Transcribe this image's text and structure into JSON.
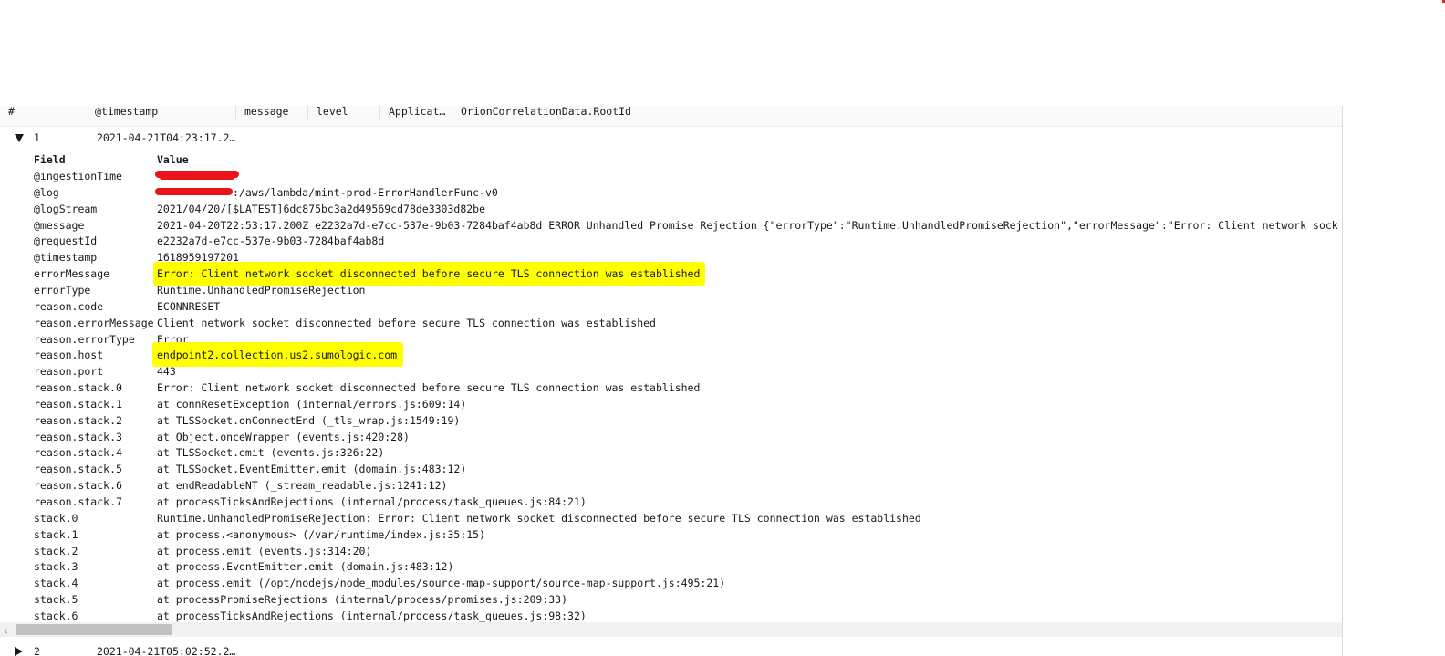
{
  "columns": [
    "#",
    "@timestamp",
    "message",
    "level",
    "Applicat…",
    "OrionCorrelationData.RootId"
  ],
  "rows": [
    {
      "num": "1",
      "timestamp": "2021-04-21T04:23:17.2…",
      "expanded": true
    },
    {
      "num": "2",
      "timestamp": "2021-04-21T05:02:52.2…",
      "expanded": false
    }
  ],
  "detail_headers": {
    "field": "Field",
    "value": "Value"
  },
  "fields": [
    {
      "name": "@ingestionTime",
      "value": ""
    },
    {
      "name": "@log",
      "value": ":/aws/lambda/mint-prod-ErrorHandlerFunc-v0"
    },
    {
      "name": "@logStream",
      "value": "2021/04/20/[$LATEST]6dc875bc3a2d49569cd78de3303d82be"
    },
    {
      "name": "@message",
      "value": "2021-04-20T22:53:17.200Z e2232a7d-e7cc-537e-9b03-7284baf4ab8d ERROR Unhandled Promise Rejection {\"errorType\":\"Runtime.UnhandledPromiseRejection\",\"errorMessage\":\"Error: Client network sock"
    },
    {
      "name": "@requestId",
      "value": "e2232a7d-e7cc-537e-9b03-7284baf4ab8d"
    },
    {
      "name": "@timestamp",
      "value": "1618959197201"
    },
    {
      "name": "errorMessage",
      "value": "Error: Client network socket disconnected before secure TLS connection was established"
    },
    {
      "name": "errorType",
      "value": "Runtime.UnhandledPromiseRejection"
    },
    {
      "name": "reason.code",
      "value": "ECONNRESET"
    },
    {
      "name": "reason.errorMessage",
      "value": "Client network socket disconnected before secure TLS connection was established"
    },
    {
      "name": "reason.errorType",
      "value": "Error"
    },
    {
      "name": "reason.host",
      "value": "endpoint2.collection.us2.sumologic.com"
    },
    {
      "name": "reason.port",
      "value": "443"
    },
    {
      "name": "reason.stack.0",
      "value": "Error: Client network socket disconnected before secure TLS connection was established"
    },
    {
      "name": "reason.stack.1",
      "value": "at connResetException (internal/errors.js:609:14)"
    },
    {
      "name": "reason.stack.2",
      "value": "at TLSSocket.onConnectEnd (_tls_wrap.js:1549:19)"
    },
    {
      "name": "reason.stack.3",
      "value": "at Object.onceWrapper (events.js:420:28)"
    },
    {
      "name": "reason.stack.4",
      "value": "at TLSSocket.emit (events.js:326:22)"
    },
    {
      "name": "reason.stack.5",
      "value": "at TLSSocket.EventEmitter.emit (domain.js:483:12)"
    },
    {
      "name": "reason.stack.6",
      "value": "at endReadableNT (_stream_readable.js:1241:12)"
    },
    {
      "name": "reason.stack.7",
      "value": "at processTicksAndRejections (internal/process/task_queues.js:84:21)"
    },
    {
      "name": "stack.0",
      "value": "Runtime.UnhandledPromiseRejection: Error: Client network socket disconnected before secure TLS connection was established"
    },
    {
      "name": "stack.1",
      "value": "at process.<anonymous> (/var/runtime/index.js:35:15)"
    },
    {
      "name": "stack.2",
      "value": "at process.emit (events.js:314:20)"
    },
    {
      "name": "stack.3",
      "value": "at process.EventEmitter.emit (domain.js:483:12)"
    },
    {
      "name": "stack.4",
      "value": "at process.emit (/opt/nodejs/node_modules/source-map-support/source-map-support.js:495:21)"
    },
    {
      "name": "stack.5",
      "value": "at processPromiseRejections (internal/process/promises.js:209:33)"
    },
    {
      "name": "stack.6",
      "value": "at processTicksAndRejections (internal/process/task_queues.js:98:32)"
    }
  ],
  "scrollbar": {
    "left_arrow": "‹"
  },
  "colors": {
    "highlight": "#ffff00",
    "redaction": "#e8141a",
    "text": "#16191f"
  }
}
